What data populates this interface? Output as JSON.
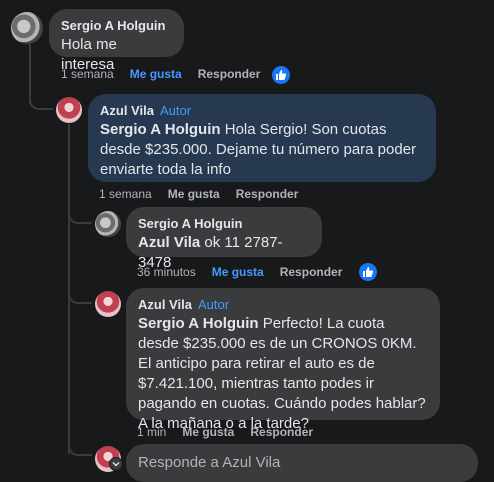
{
  "comments": [
    {
      "author": "Sergio A Holguin",
      "text": "Hola me interesa",
      "mention": "",
      "time": "1 semana",
      "like_label": "Me gusta",
      "reply_label": "Responder",
      "liked": true
    },
    {
      "author": "Azul Vila",
      "badge": "Autor",
      "mention": "Sergio A Holguin",
      "text": " Hola Sergio! Son cuotas desde $235.000. Dejame tu número para poder enviarte toda la info",
      "time": "1 semana",
      "like_label": "Me gusta",
      "reply_label": "Responder",
      "liked": false
    },
    {
      "author": "Sergio A Holguin",
      "mention": "Azul Vila",
      "text": " ok 11 2787-3478",
      "time": "36 minutos",
      "like_label": "Me gusta",
      "reply_label": "Responder",
      "liked": true
    },
    {
      "author": "Azul Vila",
      "badge": "Autor",
      "mention": "Sergio A Holguin",
      "text": " Perfecto! La cuota desde $235.000 es de un CRONOS 0KM. El anticipo para retirar el auto es de $7.421.100, mientras tanto podes ir pagando en cuotas. Cuándo podes hablar? A la mañana o a la tarde?",
      "time": "1 min",
      "like_label": "Me gusta",
      "reply_label": "Responder",
      "liked": false
    }
  ],
  "reply_input": {
    "placeholder": "Responde a Azul Vila"
  },
  "colors": {
    "background": "#18191a",
    "bubble": "#3a3b3c",
    "author_bubble": "#263951",
    "accent": "#4599ff"
  },
  "icons": {
    "like_reaction": "thumbs-up-icon",
    "avatar_expand": "chevron-down-icon"
  }
}
